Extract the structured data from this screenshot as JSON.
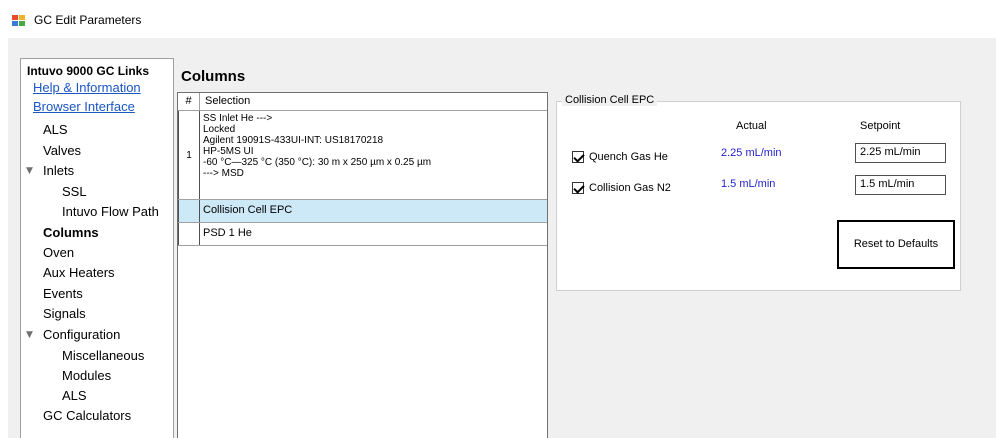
{
  "window": {
    "title": "GC Edit Parameters"
  },
  "nav": {
    "heading": "Intuvo 9000 GC Links",
    "links": [
      "Help & Information",
      "Browser Interface"
    ],
    "items": [
      {
        "label": "ALS"
      },
      {
        "label": "Valves"
      },
      {
        "label": "Inlets",
        "expanded": true
      },
      {
        "label": "SSL"
      },
      {
        "label": "Intuvo Flow Path"
      },
      {
        "label": "Columns",
        "selected": true
      },
      {
        "label": "Oven"
      },
      {
        "label": "Aux Heaters"
      },
      {
        "label": "Events"
      },
      {
        "label": "Signals"
      },
      {
        "label": "Configuration",
        "expanded": true
      },
      {
        "label": "Miscellaneous"
      },
      {
        "label": "Modules"
      },
      {
        "label": "ALS"
      },
      {
        "label": "GC Calculators"
      }
    ]
  },
  "main": {
    "title": "Columns",
    "grid": {
      "headers": [
        "#",
        "Selection"
      ],
      "rows": [
        {
          "num": "1",
          "lines": [
            "SS Inlet He --->",
            "Locked",
            "Agilent 19091S-433UI-INT: US18170218",
            "HP-5MS UI",
            "-60 °C—325 °C (350 °C): 30 m x 250 µm x 0.25 µm",
            "---> MSD"
          ]
        },
        {
          "num": "",
          "lines": [
            "Collision Cell EPC"
          ],
          "selected": true
        },
        {
          "num": "",
          "lines": [
            "PSD 1 He"
          ]
        }
      ]
    }
  },
  "epc": {
    "group_title": "Collision Cell EPC",
    "col_actual": "Actual",
    "col_setpoint": "Setpoint",
    "params": [
      {
        "label": "Quench Gas He",
        "checked": true,
        "actual": "2.25 mL/min",
        "setpoint": "2.25 mL/min"
      },
      {
        "label": "Collision Gas N2",
        "checked": true,
        "actual": "1.5 mL/min",
        "setpoint": "1.5 mL/min"
      }
    ],
    "reset_label": "Reset to Defaults"
  },
  "colors": {
    "link": "#1a56c4",
    "actual_value": "#2222cc",
    "selected_row": "#cde8f7",
    "panel_bg": "#f0f0f0"
  }
}
